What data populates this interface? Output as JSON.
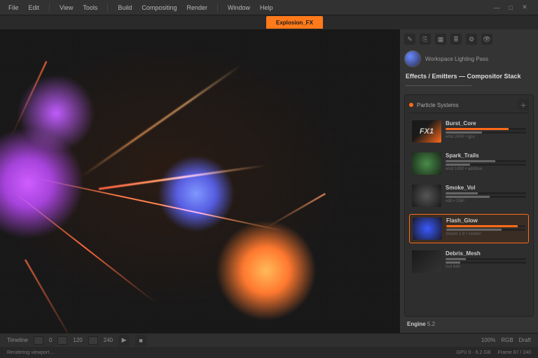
{
  "menu": [
    "File",
    "Edit",
    "View",
    "Tools",
    "Build",
    "Compositing",
    "Render",
    "Window",
    "Help"
  ],
  "tab": {
    "active": "Explosion_FX"
  },
  "win": {
    "min": "—",
    "max": "□",
    "close": "✕"
  },
  "side": {
    "toprow_icons": [
      "edit",
      "link",
      "grid",
      "list",
      "settings",
      "eye"
    ],
    "user": "Workspace Lighting Pass",
    "title": "Effects / Emitters — Compositor Stack",
    "inspector_label": "Particle Systems",
    "assets": [
      {
        "name": "FX1",
        "label": "Burst_Core",
        "p1": 78,
        "p2": 45,
        "meta": "emit 2400 • gpu"
      },
      {
        "name": "",
        "label": "Spark_Trails",
        "p1": 62,
        "p2": 30,
        "meta": "emit 1800 • additive",
        "thumb": "t-fx2"
      },
      {
        "name": "",
        "label": "Smoke_Vol",
        "p1": 40,
        "p2": 55,
        "meta": "vdb • 256³",
        "thumb": "t-fx3"
      },
      {
        "name": "",
        "label": "Flash_Glow",
        "p1": 90,
        "p2": 70,
        "meta": "bloom 1.8 • screen",
        "thumb": "t-fx4",
        "sel": true
      },
      {
        "name": "",
        "label": "Debris_Mesh",
        "p1": 25,
        "p2": 18,
        "meta": "inst 640",
        "thumb": "t-fx5"
      }
    ],
    "brand": "Engine",
    "brand_ver": "5.2"
  },
  "bottom": {
    "items": [
      "Timeline",
      "0",
      "120",
      "240",
      "▶",
      "■"
    ],
    "right": [
      "100%",
      "RGB",
      "Draft"
    ]
  },
  "status": {
    "left": "Rendering viewport…",
    "mid": "GPU 0 · 6.2 GB",
    "right": "Frame 87 / 240"
  }
}
